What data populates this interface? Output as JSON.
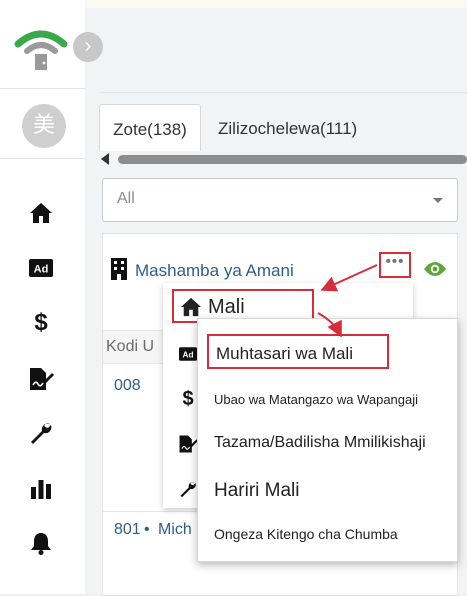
{
  "sidebar": {
    "avatar_text": "美",
    "icons": [
      "home-icon",
      "ad-icon",
      "dollar-icon",
      "signed-document-icon",
      "wrench-icon",
      "bar-chart-icon",
      "bell-icon"
    ]
  },
  "tabs": [
    {
      "label": "Zote(138)"
    },
    {
      "label": "Zilizochelewa(111)"
    }
  ],
  "filter": {
    "value": "All"
  },
  "property": {
    "title": "Mashamba ya Amani",
    "column_header": "Kodi U",
    "codes": [
      "008",
      "801"
    ],
    "second_row_text": "Mich"
  },
  "menu_primary": {
    "title": "Mali",
    "icons": [
      "ad-icon",
      "dollar-icon",
      "signed-document-icon",
      "wrench-icon"
    ]
  },
  "menu_secondary": {
    "items": [
      "Muhtasari wa Mali",
      "Ubao wa Matangazo wa Wapangaji",
      "Tazama/Badilisha Mmilikishaji",
      "Hariri Mali",
      "Ongeza Kitengo cha Chumba"
    ]
  },
  "colors": {
    "accent_blue": "#2d5f8b",
    "highlight_red": "#d62d3a",
    "logo_green": "#3aa94a",
    "eye_green": "#5ea63a"
  }
}
